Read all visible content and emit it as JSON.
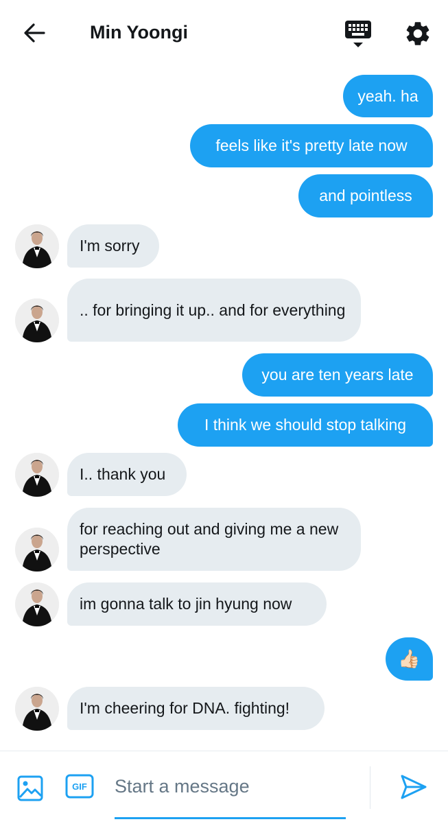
{
  "header": {
    "title": "Min Yoongi"
  },
  "icons": {
    "back": "back-arrow-icon",
    "keyboard": "keyboard-icon",
    "settings": "gear-icon",
    "image": "image-icon",
    "gif": "gif-icon",
    "send": "send-icon",
    "thumbs_up": "thumbs-up-icon"
  },
  "colors": {
    "accent": "#1da1f2",
    "incoming_bubble": "#e6ecf0",
    "text": "#14171a",
    "placeholder": "#657786"
  },
  "messages": [
    {
      "from": "me",
      "text": "yeah. ha"
    },
    {
      "from": "me",
      "text": "feels like it's pretty late now"
    },
    {
      "from": "me",
      "text": "and pointless"
    },
    {
      "from": "them",
      "text": "I'm sorry"
    },
    {
      "from": "them",
      "text": ".. for bringing it up.. and for everything"
    },
    {
      "from": "me",
      "text": "you are ten years late"
    },
    {
      "from": "me",
      "text": "I think we should stop talking"
    },
    {
      "from": "them",
      "text": "I.. thank you"
    },
    {
      "from": "them",
      "text": "for reaching out and giving me a new perspective"
    },
    {
      "from": "them",
      "text": "im gonna talk to jin hyung now"
    },
    {
      "from": "me",
      "text": "👍🏻"
    },
    {
      "from": "them",
      "text": "I'm cheering for DNA. fighting!"
    }
  ],
  "composer": {
    "gif_label": "GIF",
    "placeholder": "Start a message"
  }
}
